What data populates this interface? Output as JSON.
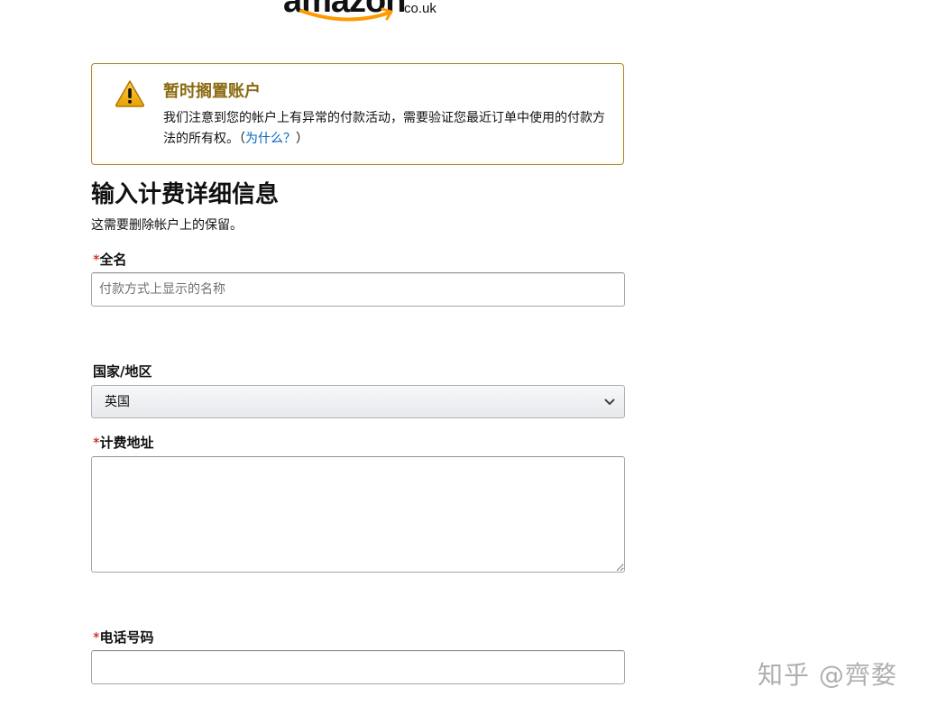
{
  "logo": {
    "word": "amazon",
    "domain": "co.uk"
  },
  "alert": {
    "icon": "warning-icon",
    "title": "暂时搁置账户",
    "body": "我们注意到您的帐户上有异常的付款活动，需要验证您最近订单中使用的付款方法的所有权。",
    "link_open": "（",
    "link_text": "为什么？",
    "link_close": "）",
    "title_color": "#8a6a12",
    "border_color": "#a88734",
    "link_color": "#0066c0"
  },
  "form": {
    "heading": "输入计费详细信息",
    "subheading": "这需要删除帐户上的保留。",
    "required_mark": "*",
    "full_name": {
      "label": "全名",
      "placeholder": "付款方式上显示的名称",
      "value": ""
    },
    "country": {
      "label": "国家/地区",
      "selected": "英国",
      "icon": "chevron-down-icon"
    },
    "billing_address": {
      "label": "计费地址",
      "value": ""
    },
    "phone": {
      "label": "电话号码",
      "value": ""
    }
  },
  "watermark": "知乎 @齊婺"
}
